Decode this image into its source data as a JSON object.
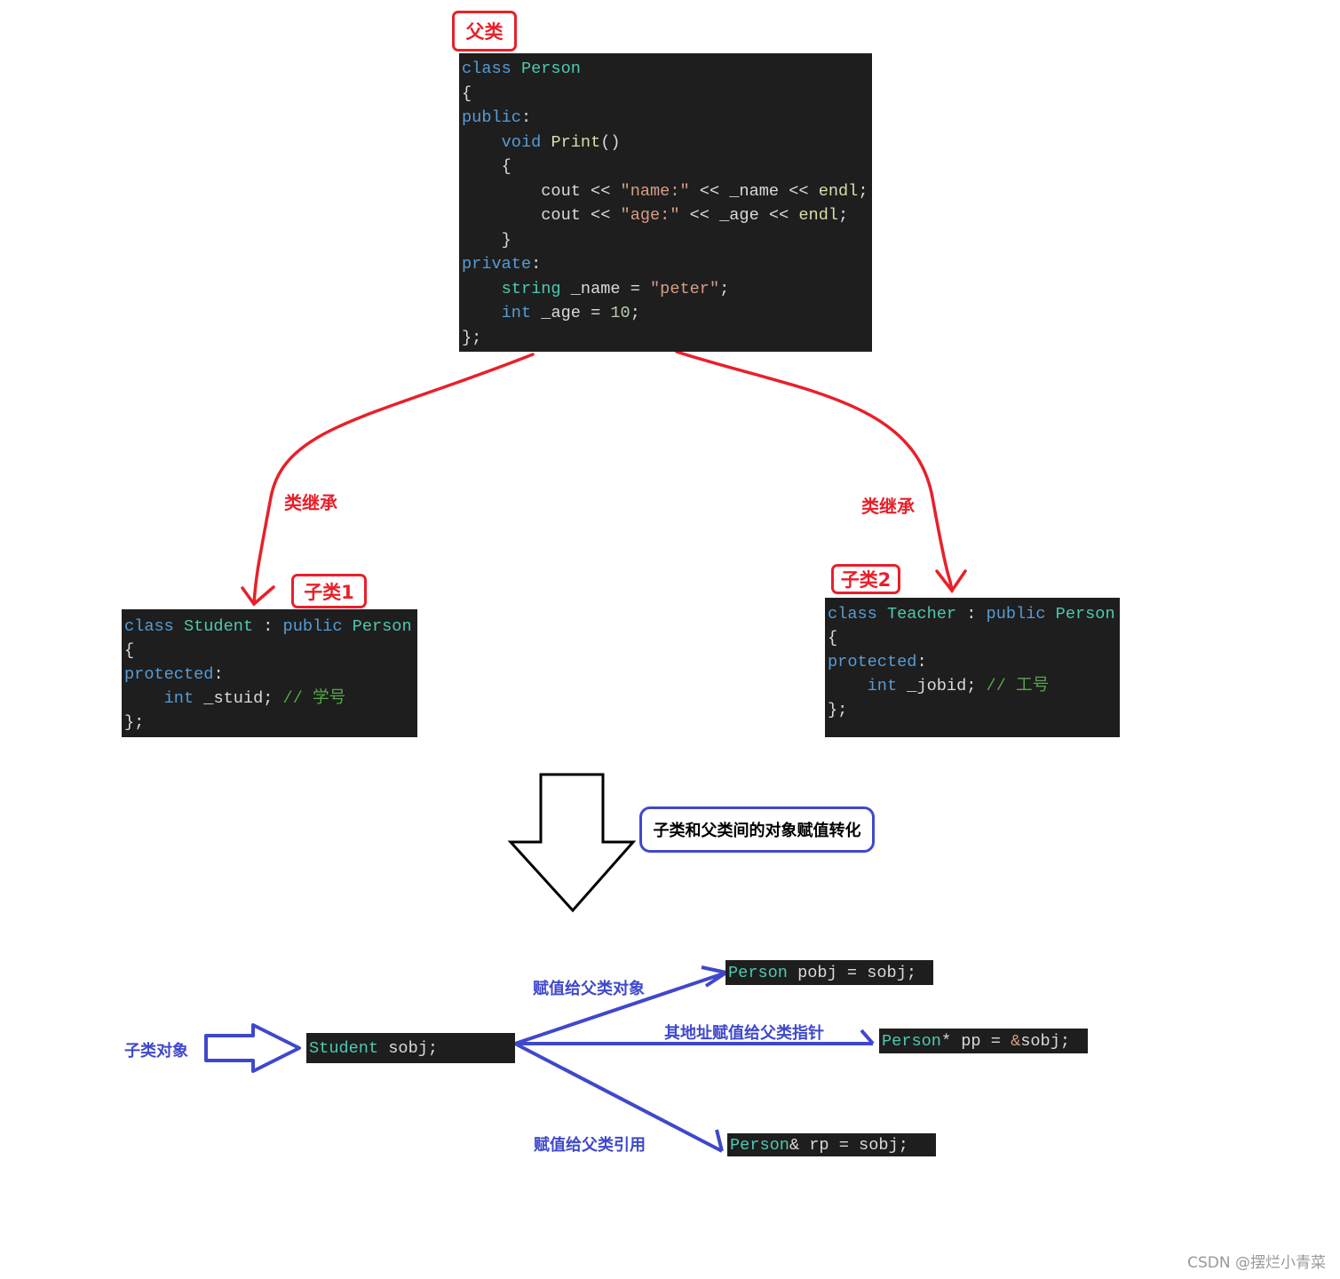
{
  "labels": {
    "parent": "父类",
    "child1": "子类1",
    "child2": "子类2",
    "inherit_left": "类继承",
    "inherit_right": "类继承",
    "conversion_title": "子类和父类间的对象赋值转化",
    "child_object": "子类对象",
    "assign_object": "赋值给父类对象",
    "assign_pointer": "其地址赋值给父类指针",
    "assign_reference": "赋值给父类引用"
  },
  "colors": {
    "red": "#e8202a",
    "blue": "#3f48cc",
    "code_bg": "#1e1e1e"
  },
  "code_blocks": {
    "person": [
      [
        [
          "class ",
          "kw"
        ],
        [
          "Person",
          "ty"
        ]
      ],
      [
        [
          "{",
          "id"
        ]
      ],
      [
        [
          "public",
          "kw"
        ],
        [
          ":",
          "id"
        ]
      ],
      [
        [
          "    ",
          "id"
        ],
        [
          "void ",
          "kw"
        ],
        [
          "Print",
          "fn"
        ],
        [
          "()",
          "id"
        ]
      ],
      [
        [
          "    {",
          "id"
        ]
      ],
      [
        [
          "        cout << ",
          "id"
        ],
        [
          "\"name:\"",
          "str"
        ],
        [
          " << _name << ",
          "id"
        ],
        [
          "endl",
          "fn"
        ],
        [
          ";",
          "id"
        ]
      ],
      [
        [
          "        cout << ",
          "id"
        ],
        [
          "\"age:\"",
          "str"
        ],
        [
          " << _age << ",
          "id"
        ],
        [
          "endl",
          "fn"
        ],
        [
          ";",
          "id"
        ]
      ],
      [
        [
          "    }",
          "id"
        ]
      ],
      [
        [
          "private",
          "kw"
        ],
        [
          ":",
          "id"
        ]
      ],
      [
        [
          "    ",
          "id"
        ],
        [
          "string ",
          "ty"
        ],
        [
          "_name = ",
          "id"
        ],
        [
          "\"peter\"",
          "str"
        ],
        [
          ";",
          "id"
        ]
      ],
      [
        [
          "    ",
          "id"
        ],
        [
          "int ",
          "kw"
        ],
        [
          "_age = ",
          "id"
        ],
        [
          "10",
          "num"
        ],
        [
          ";",
          "id"
        ]
      ],
      [
        [
          "};",
          "id"
        ]
      ]
    ],
    "student": [
      [
        [
          "class ",
          "kw"
        ],
        [
          "Student ",
          "ty"
        ],
        [
          ": ",
          "id"
        ],
        [
          "public ",
          "kw"
        ],
        [
          "Person",
          "ty"
        ]
      ],
      [
        [
          "{",
          "id"
        ]
      ],
      [
        [
          "protected",
          "kw"
        ],
        [
          ":",
          "id"
        ]
      ],
      [
        [
          "    ",
          "id"
        ],
        [
          "int ",
          "kw"
        ],
        [
          "_stuid; ",
          "id"
        ],
        [
          "// 学号",
          "cm"
        ]
      ],
      [
        [
          "};",
          "id"
        ]
      ]
    ],
    "teacher": [
      [
        [
          "class ",
          "kw"
        ],
        [
          "Teacher ",
          "ty"
        ],
        [
          ": ",
          "id"
        ],
        [
          "public ",
          "kw"
        ],
        [
          "Person",
          "ty"
        ]
      ],
      [
        [
          "{",
          "id"
        ]
      ],
      [
        [
          "protected",
          "kw"
        ],
        [
          ":",
          "id"
        ]
      ],
      [
        [
          "    ",
          "id"
        ],
        [
          "int ",
          "kw"
        ],
        [
          "_jobid; ",
          "id"
        ],
        [
          "// 工号",
          "cm"
        ]
      ],
      [
        [
          "};",
          "id"
        ]
      ]
    ],
    "sobj": [
      [
        [
          "Student ",
          "ty"
        ],
        [
          "sobj;",
          "id"
        ]
      ]
    ],
    "pobj": [
      [
        [
          "Person ",
          "ty"
        ],
        [
          "pobj = sobj;",
          "id"
        ]
      ]
    ],
    "pp": [
      [
        [
          "Person",
          "ty"
        ],
        [
          "* pp = ",
          "id"
        ],
        [
          "&",
          "str"
        ],
        [
          "sobj;",
          "id"
        ]
      ]
    ],
    "rp": [
      [
        [
          "Person",
          "ty"
        ],
        [
          "& rp = sobj;",
          "id"
        ]
      ]
    ]
  },
  "watermark": "CSDN @摆烂小青菜"
}
